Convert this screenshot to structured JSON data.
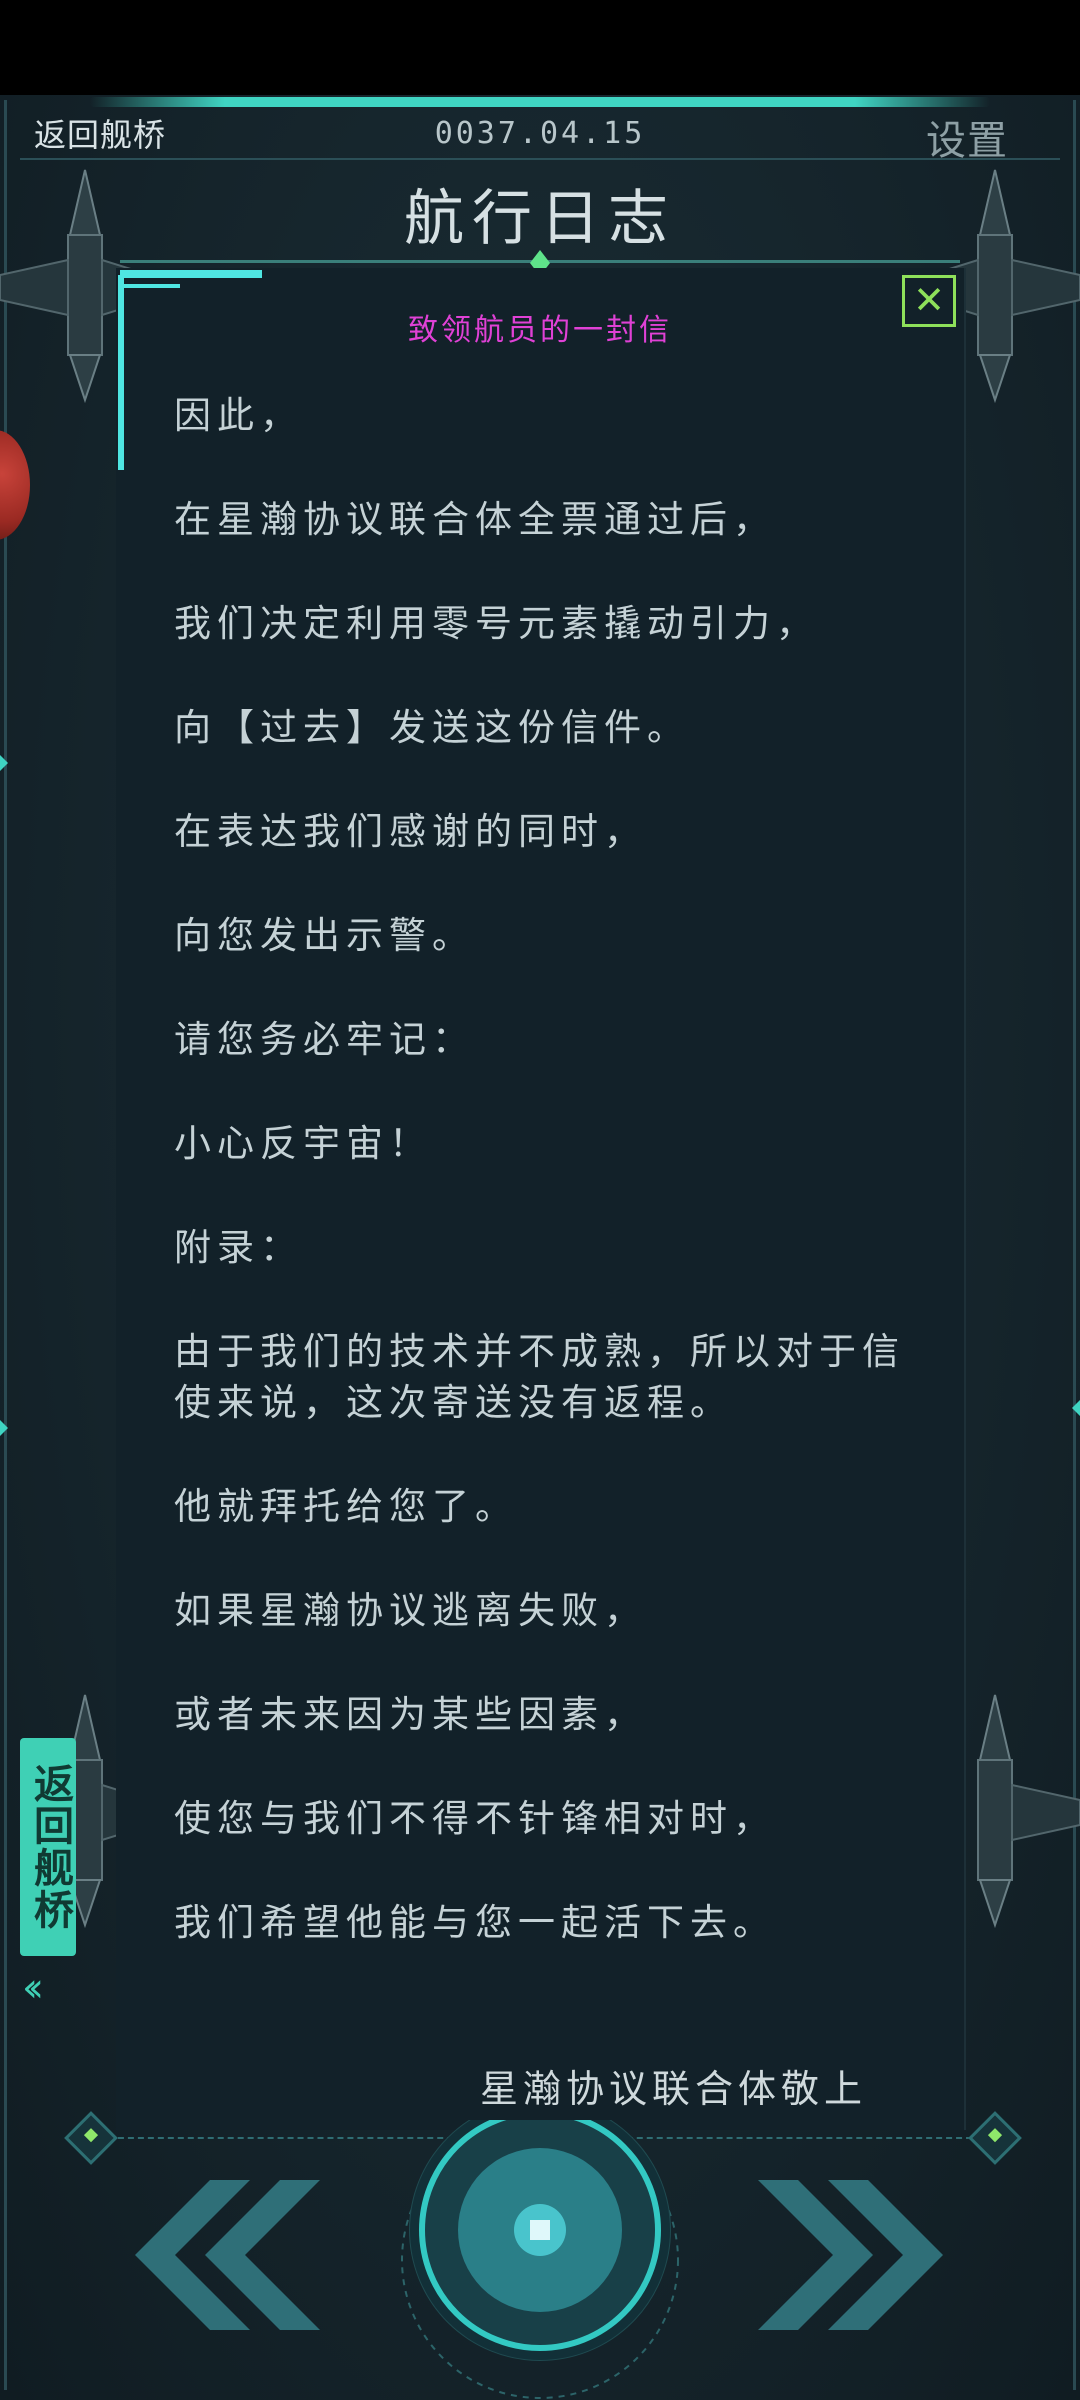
{
  "header": {
    "back_label": "返回舰桥",
    "date": "0037.04.15",
    "settings_label": "设置",
    "title": "航行日志"
  },
  "letter": {
    "subtitle": "致领航员的一封信",
    "paragraphs": [
      "因此，",
      "在星瀚协议联合体全票通过后，",
      "我们决定利用零号元素撬动引力，",
      "向【过去】发送这份信件。",
      "在表达我们感谢的同时，",
      "向您发出示警。",
      "请您务必牢记：",
      "小心反宇宙！",
      "附录：",
      "由于我们的技术并不成熟，所以对于信使来说，这次寄送没有返程。",
      "他就拜托给您了。",
      "如果星瀚协议逃离失败，",
      "或者未来因为某些因素，",
      "使您与我们不得不针锋相对时，",
      "我们希望他能与您一起活下去。"
    ],
    "signature": "星瀚协议联合体敬上"
  },
  "controls": {
    "close_icon": "close-x-icon",
    "side_tab_label": "返回舰桥",
    "side_tab_arrows": "‹‹",
    "prev_icon": "double-chevron-left-icon",
    "next_icon": "double-chevron-right-icon",
    "center_icon": "round-core-button-icon"
  },
  "colors": {
    "accent": "#3fd4c2",
    "subtitle": "#e041d6",
    "close": "#8ee05a",
    "background": "#16262e"
  }
}
